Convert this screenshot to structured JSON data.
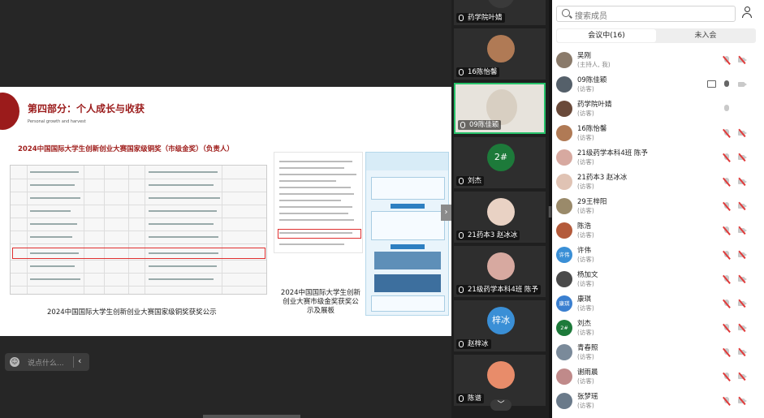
{
  "slide": {
    "section_title": "第四部分：个人成长与收获",
    "section_subtitle": "Personal growth and harvest",
    "award_title": "2024中国国际大学生创新创业大赛国家级铜奖（市级金奖）（负责人）",
    "caption_left": "2024中国国际大学生创新创业大赛国家级铜奖获奖公示",
    "caption_right": "2024中国国际大学生创新创业大赛市级金奖获奖公示及展板"
  },
  "chat": {
    "placeholder": "说点什么...",
    "emoji_icon": "☺",
    "collapse_icon": "‹"
  },
  "video_tiles": [
    {
      "name": "药学院叶婧",
      "avatar_text": "",
      "avatar_color": "#3a3a3a"
    },
    {
      "name": "16陈怡馨",
      "avatar_text": "",
      "avatar_color": "#b07a55"
    },
    {
      "name": "09陈佳颖",
      "avatar_text": "",
      "avatar_color": "#d8cfc2",
      "active": true
    },
    {
      "name": "刘杰",
      "avatar_text": "2# 303",
      "avatar_color": "#1d7a3a"
    },
    {
      "name": "21药本3 赵冰冰",
      "avatar_text": "",
      "avatar_color": "#e9d2c4"
    },
    {
      "name": "21级药学本科4班 陈予",
      "avatar_text": "",
      "avatar_color": "#d7a9a0"
    },
    {
      "name": "赵梓冰",
      "avatar_text": "梓冰",
      "avatar_color": "#3a8fd6"
    },
    {
      "name": "陈谱",
      "avatar_text": "",
      "avatar_color": "#e88c6a"
    }
  ],
  "members": {
    "search_placeholder": "搜索成员",
    "tab_in_meeting": "会议中(16)",
    "tab_not_joined": "未入会",
    "list": [
      {
        "name": "吴刚",
        "role": "(主持人, 我)",
        "avatar_text": "",
        "avatar_color": "#8a7a6a",
        "mic": "off",
        "cam": "off"
      },
      {
        "name": "09陈佳颖",
        "role": "(访客)",
        "avatar_text": "",
        "avatar_color": "#55606a",
        "mic": "on",
        "cam": "on",
        "share": true
      },
      {
        "name": "药学院叶婧",
        "role": "(访客)",
        "avatar_text": "",
        "avatar_color": "#6a4a3a",
        "mic": "plain",
        "cam": "none"
      },
      {
        "name": "16陈怡馨",
        "role": "(访客)",
        "avatar_text": "",
        "avatar_color": "#b07a55",
        "mic": "off",
        "cam": "off"
      },
      {
        "name": "21级药学本科4班 陈予",
        "role": "(访客)",
        "avatar_text": "",
        "avatar_color": "#d7a9a0",
        "mic": "off",
        "cam": "off"
      },
      {
        "name": "21药本3 赵冰冰",
        "role": "(访客)",
        "avatar_text": "",
        "avatar_color": "#e0c3b4",
        "mic": "off",
        "cam": "off"
      },
      {
        "name": "29王梓阳",
        "role": "(访客)",
        "avatar_text": "",
        "avatar_color": "#9a8a6a",
        "mic": "off",
        "cam": "off"
      },
      {
        "name": "陈浩",
        "role": "(访客)",
        "avatar_text": "",
        "avatar_color": "#b45a3a",
        "mic": "off",
        "cam": "off"
      },
      {
        "name": "许伟",
        "role": "(访客)",
        "avatar_text": "许伟",
        "avatar_color": "#3a8fd6",
        "mic": "off",
        "cam": "off"
      },
      {
        "name": "杨加文",
        "role": "(访客)",
        "avatar_text": "",
        "avatar_color": "#4a4a4a",
        "mic": "off",
        "cam": "off"
      },
      {
        "name": "康琪",
        "role": "(访客)",
        "avatar_text": "康琪",
        "avatar_color": "#3a7fd0",
        "mic": "off",
        "cam": "off"
      },
      {
        "name": "刘杰",
        "role": "(访客)",
        "avatar_text": "2# 303",
        "avatar_color": "#1d7a3a",
        "mic": "off",
        "cam": "off"
      },
      {
        "name": "青春照",
        "role": "(访客)",
        "avatar_text": "",
        "avatar_color": "#7a8a9a",
        "mic": "off",
        "cam": "off"
      },
      {
        "name": "谢雨晨",
        "role": "(访客)",
        "avatar_text": "",
        "avatar_color": "#c08a8a",
        "mic": "off",
        "cam": "off"
      },
      {
        "name": "张梦瑶",
        "role": "(访客)",
        "avatar_text": "",
        "avatar_color": "#6a7a8a",
        "mic": "off",
        "cam": "off"
      }
    ]
  }
}
